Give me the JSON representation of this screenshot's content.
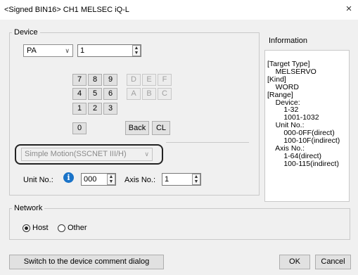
{
  "window": {
    "title": "<Signed BIN16> CH1 MELSEC iQ-L",
    "close_glyph": "×"
  },
  "device": {
    "legend": "Device",
    "type_value": "PA",
    "number_value": "1",
    "keypad": {
      "row1": [
        "7",
        "8",
        "9"
      ],
      "row2": [
        "4",
        "5",
        "6"
      ],
      "row3": [
        "1",
        "2",
        "3"
      ],
      "zero": "0",
      "hex_row1": [
        "D",
        "E",
        "F"
      ],
      "hex_row2": [
        "A",
        "B",
        "C"
      ],
      "back": "Back",
      "clear": "CL"
    },
    "network_type_value": "Simple Motion(SSCNET III/H)",
    "unit_no_label": "Unit No.:",
    "unit_no_value": "000",
    "axis_no_label": "Axis No.:",
    "axis_no_value": "1"
  },
  "information": {
    "legend": "Information",
    "text": "[Target Type]\n    MELSERVO\n[Kind]\n    WORD\n[Range]\n    Device:\n        1-32\n        1001-1032\n    Unit No.:\n        000-0FF(direct)\n        100-10F(indirect)\n    Axis No.:\n        1-64(direct)\n        100-115(indirect)"
  },
  "network": {
    "legend": "Network",
    "option_host": "Host",
    "option_other": "Other",
    "selected": "Host"
  },
  "footer": {
    "comment_button": "Switch to the device comment dialog",
    "ok_button": "OK",
    "cancel_button": "Cancel"
  },
  "colors": {
    "info_icon": "#1a73c8",
    "background": "#f0f0f0",
    "highlight_border": "#222222"
  },
  "icons": {
    "unit_info": "info-icon",
    "dropdown": "chevron-down-icon",
    "spinner": "spinner-arrows-icon"
  }
}
